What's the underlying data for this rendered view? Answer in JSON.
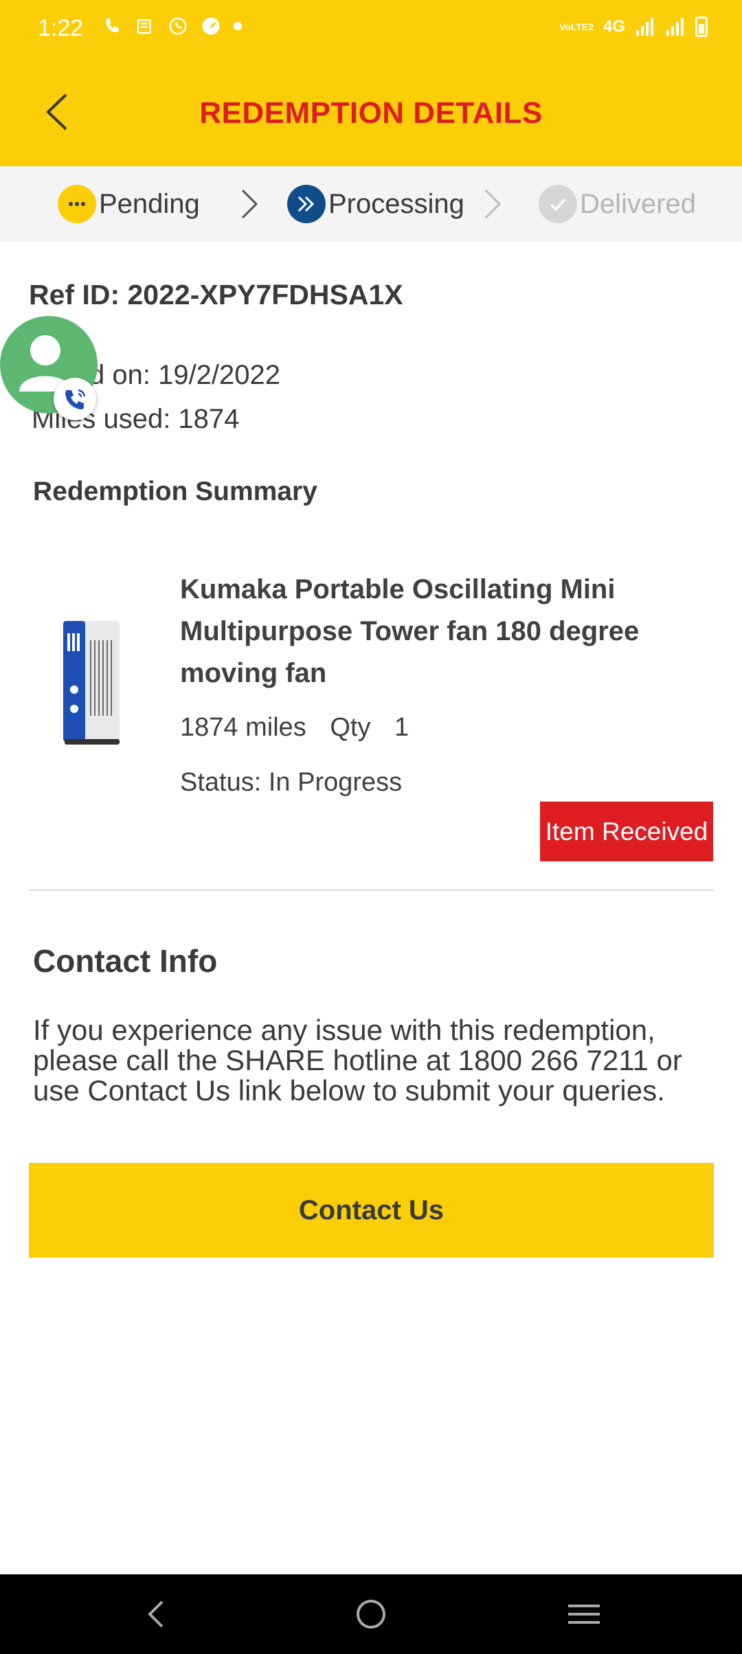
{
  "status_bar": {
    "time": "1:22",
    "network": "4G",
    "volte": "VoLTE2"
  },
  "header": {
    "title": "REDEMPTION DETAILS"
  },
  "steps": [
    {
      "label": "Pending",
      "state": "done"
    },
    {
      "label": "Processing",
      "state": "active"
    },
    {
      "label": "Delivered",
      "state": "inactive"
    }
  ],
  "order": {
    "ref_id": "Ref ID: 2022-XPY7FDHSA1X",
    "placed_on": "d on: 19/2/2022",
    "miles_used": "Miles used: 1874"
  },
  "summary": {
    "heading": "Redemption Summary",
    "product_title": "Kumaka Portable Oscillating Mini Multipurpose Tower fan 180 degree moving fan",
    "miles": "1874 miles",
    "qty_label": "Qty",
    "qty_value": "1",
    "status": "Status: In Progress",
    "badge": "Item Received"
  },
  "contact": {
    "heading": "Contact Info",
    "text": "If you experience any issue with this redemption, please call the SHARE hotline at 1800 266 7211 or use Contact Us link below to submit your queries.",
    "button": "Contact Us"
  },
  "colors": {
    "brand_yellow": "#fbce07",
    "brand_red": "#dd1d21",
    "processing_blue": "#0f4c8a",
    "chat_green": "#5cb870"
  }
}
